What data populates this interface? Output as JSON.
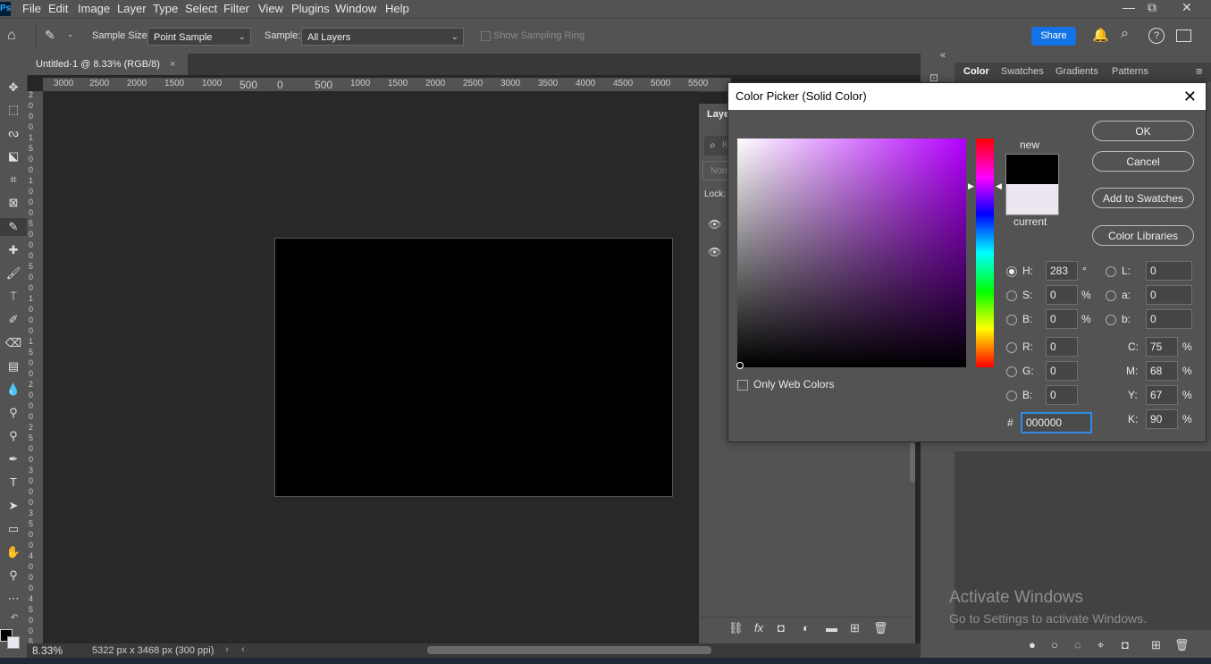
{
  "menubar": {
    "logo": "Ps",
    "items": [
      "File",
      "Edit",
      "Image",
      "Layer",
      "Type",
      "Select",
      "Filter",
      "View",
      "Plugins",
      "Window",
      "Help"
    ],
    "controls": [
      "—",
      "⧉",
      "✕"
    ]
  },
  "options_bar": {
    "sample_size_label": "Sample Size:",
    "sample_size_value": "Point Sample",
    "sample_label": "Sample:",
    "sample_value": "All Layers",
    "show_sampling_ring_label": "Show Sampling Ring",
    "share_label": "Share"
  },
  "document": {
    "tab_title": "Untitled-1 @ 8.33% (RGB/8)",
    "tab_close": "×",
    "zoom": "8.33%",
    "dimensions": "5322 px x 3468 px (300 ppi)"
  },
  "ruler": {
    "h_ticks": [
      "3000",
      "2500",
      "2000",
      "1500",
      "1000",
      "500",
      "0",
      "500",
      "1000",
      "1500",
      "2000",
      "2500",
      "3000",
      "3500",
      "4000",
      "4500",
      "5000",
      "5500"
    ],
    "v_ticks": [
      "2",
      "0",
      "0",
      "0",
      "1",
      "5",
      "0",
      "0",
      "1",
      "0",
      "0",
      "0",
      "5",
      "0",
      "0",
      "0",
      "5",
      "0",
      "0",
      "1",
      "0",
      "0",
      "0",
      "1",
      "5",
      "0",
      "0",
      "2",
      "0",
      "0",
      "0",
      "2",
      "5",
      "0",
      "0",
      "3",
      "0",
      "0",
      "0",
      "3",
      "5",
      "0",
      "0",
      "4",
      "0",
      "0",
      "0",
      "4",
      "5",
      "0",
      "0",
      "5"
    ]
  },
  "layers_panel": {
    "title": "Layer",
    "search_placeholder": "K",
    "blend_mode": "Norm",
    "lock_label": "Lock:",
    "footer_icons": [
      "link-icon",
      "fx-icon",
      "mask-icon",
      "adjustment-icon",
      "folder-icon",
      "new-layer-icon",
      "trash-icon"
    ],
    "footer_glyphs": [
      "⛓",
      "fx",
      "◘",
      "◐",
      "▬",
      "⊞",
      "🗑"
    ]
  },
  "right_panel": {
    "tabs": [
      "Color",
      "Swatches",
      "Gradients",
      "Patterns"
    ],
    "active_tab": "Color"
  },
  "color_picker": {
    "title": "Color Picker (Solid Color)",
    "close": "✕",
    "buttons": {
      "ok": "OK",
      "cancel": "Cancel",
      "add_to_swatches": "Add to Swatches",
      "color_libraries": "Color Libraries"
    },
    "new_label": "new",
    "current_label": "current",
    "new_color": "#000000",
    "current_color": "#ece6f0",
    "hue_color": "#b300ff",
    "only_web_colors": "Only Web Colors",
    "hsb": {
      "h_label": "H:",
      "h_value": "283",
      "h_unit": "°",
      "s_label": "S:",
      "s_value": "0",
      "s_unit": "%",
      "b_label": "B:",
      "b_value": "0",
      "b_unit": "%"
    },
    "rgb": {
      "r_label": "R:",
      "r_value": "0",
      "g_label": "G:",
      "g_value": "0",
      "b_label": "B:",
      "b_value": "0"
    },
    "lab": {
      "l_label": "L:",
      "l_value": "0",
      "a_label": "a:",
      "a_value": "0",
      "b_label": "b:",
      "b_value": "0"
    },
    "cmyk": {
      "c_label": "C:",
      "c_value": "75",
      "m_label": "M:",
      "m_value": "68",
      "y_label": "Y:",
      "y_value": "67",
      "k_label": "K:",
      "k_value": "90",
      "unit": "%"
    },
    "hex_label": "#",
    "hex_value": "000000"
  },
  "watermark": {
    "title": "Activate Windows",
    "subtitle": "Go to Settings to activate Windows."
  }
}
